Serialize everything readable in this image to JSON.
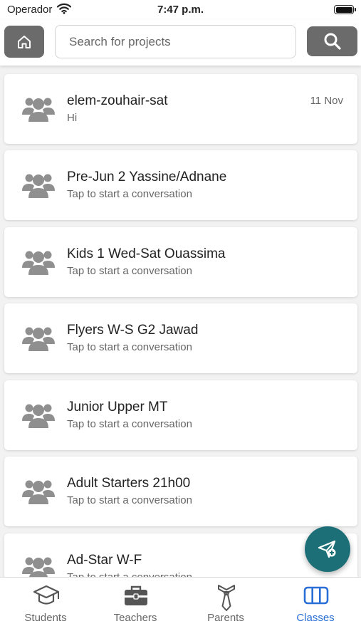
{
  "status_bar": {
    "carrier": "Operador",
    "time": "7:47 p.m."
  },
  "header": {
    "search_placeholder": "Search for projects",
    "home_icon": "home-icon",
    "search_icon": "search-icon"
  },
  "conversations": [
    {
      "name": "elem-zouhair-sat",
      "subtitle": "Hi",
      "date": "11 Nov"
    },
    {
      "name": "Pre-Jun 2 Yassine/Adnane",
      "subtitle": "Tap to start a conversation",
      "date": ""
    },
    {
      "name": "Kids 1 Wed-Sat Ouassima",
      "subtitle": "Tap to start a conversation",
      "date": ""
    },
    {
      "name": "Flyers W-S G2 Jawad",
      "subtitle": "Tap to start a conversation",
      "date": ""
    },
    {
      "name": "Junior Upper MT",
      "subtitle": "Tap to start a conversation",
      "date": ""
    },
    {
      "name": "Adult Starters 21h00",
      "subtitle": "Tap to start a conversation",
      "date": ""
    },
    {
      "name": "Ad-Star W-F",
      "subtitle": "Tap to start a conversation",
      "date": ""
    }
  ],
  "fab": {
    "icon": "send-plus-icon",
    "color": "#1c6f77"
  },
  "tabs": [
    {
      "label": "Students",
      "icon": "graduation-cap-icon",
      "active": false
    },
    {
      "label": "Teachers",
      "icon": "briefcase-icon",
      "active": false
    },
    {
      "label": "Parents",
      "icon": "tie-icon",
      "active": false
    },
    {
      "label": "Classes",
      "icon": "columns-icon",
      "active": true
    }
  ],
  "colors": {
    "accent": "#2a6fd6",
    "button_gray": "#6b6b6b",
    "fab": "#1c6f77"
  }
}
